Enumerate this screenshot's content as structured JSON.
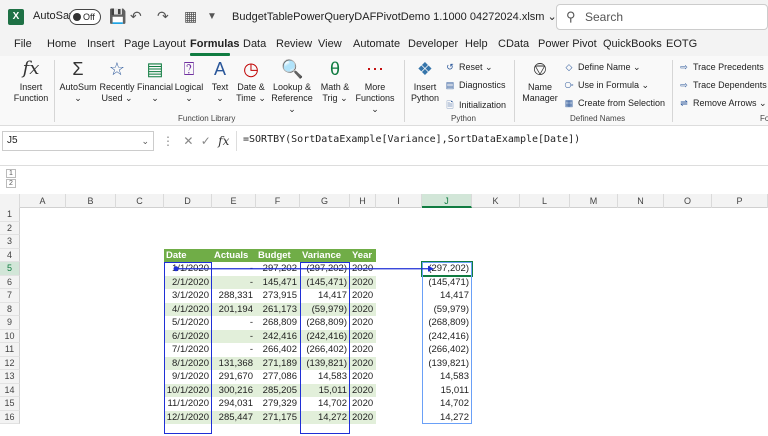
{
  "titlebar": {
    "app_badge": "X",
    "autosave_label": "AutoSave",
    "autosave_state": "Off",
    "document_title": "BudgetTablePowerQueryDAFPivotDemo 1.1000  04272024.xlsm",
    "search_placeholder": "Search"
  },
  "tabs": [
    "File",
    "Home",
    "Insert",
    "Page Layout",
    "Formulas",
    "Data",
    "Review",
    "View",
    "Automate",
    "Developer",
    "Help",
    "CData",
    "Power Pivot",
    "QuickBooks",
    "EOTG"
  ],
  "active_tab": "Formulas",
  "ribbon": {
    "insert_function": [
      "Insert",
      "Function"
    ],
    "autosum": "AutoSum",
    "recently_used": [
      "Recently",
      "Used"
    ],
    "financial": "Financial",
    "logical": "Logical",
    "text": "Text",
    "date_time": [
      "Date &",
      "Time"
    ],
    "lookup_reference": [
      "Lookup &",
      "Reference"
    ],
    "math_trig": [
      "Math &",
      "Trig"
    ],
    "more_functions": [
      "More",
      "Functions"
    ],
    "group_function_library": "Function Library",
    "insert_python": [
      "Insert",
      "Python"
    ],
    "reset": "Reset",
    "diagnostics": "Diagnostics",
    "initialization": "Initialization",
    "group_python": "Python",
    "name_manager": [
      "Name",
      "Manager"
    ],
    "define_name": "Define Name",
    "use_in_formula": "Use in Formula",
    "create_from_selection": "Create from Selection",
    "group_defined_names": "Defined Names",
    "trace_precedents": "Trace Precedents",
    "trace_dependents": "Trace Dependents",
    "remove_arrows": "Remove Arrows",
    "group_formula_auditing_partial": "Fo"
  },
  "formula_bar": {
    "name_box": "J5",
    "fx": "fx",
    "formula": "=SORTBY(SortDataExample[Variance],SortDataExample[Date])"
  },
  "outline_levels": [
    "1",
    "2"
  ],
  "columns": [
    "A",
    "B",
    "C",
    "D",
    "E",
    "F",
    "G",
    "H",
    "I",
    "J",
    "K",
    "L",
    "M",
    "N",
    "O",
    "P"
  ],
  "selected_column": "J",
  "rows": [
    "1",
    "2",
    "3",
    "4",
    "5",
    "6",
    "7",
    "8",
    "9",
    "10",
    "11",
    "12",
    "13",
    "14",
    "15",
    "16"
  ],
  "selected_row": "5",
  "table": {
    "headers": [
      "Date",
      "Actuals",
      "Budget",
      "Variance",
      "Year"
    ],
    "rows": [
      [
        "1/1/2020",
        "-",
        "297,202",
        "(297,202)",
        "2020"
      ],
      [
        "2/1/2020",
        "-",
        "145,471",
        "(145,471)",
        "2020"
      ],
      [
        "3/1/2020",
        "288,331",
        "273,915",
        "14,417",
        "2020"
      ],
      [
        "4/1/2020",
        "201,194",
        "261,173",
        "(59,979)",
        "2020"
      ],
      [
        "5/1/2020",
        "-",
        "268,809",
        "(268,809)",
        "2020"
      ],
      [
        "6/1/2020",
        "-",
        "242,416",
        "(242,416)",
        "2020"
      ],
      [
        "7/1/2020",
        "-",
        "266,402",
        "(266,402)",
        "2020"
      ],
      [
        "8/1/2020",
        "131,368",
        "271,189",
        "(139,821)",
        "2020"
      ],
      [
        "9/1/2020",
        "291,670",
        "277,086",
        "14,583",
        "2020"
      ],
      [
        "10/1/2020",
        "300,216",
        "285,205",
        "15,011",
        "2020"
      ],
      [
        "11/1/2020",
        "294,031",
        "279,329",
        "14,702",
        "2020"
      ],
      [
        "12/1/2020",
        "285,447",
        "271,175",
        "14,272",
        "2020"
      ]
    ]
  },
  "spill_values": [
    "(297,202)",
    "(145,471)",
    "14,417",
    "(59,979)",
    "(268,809)",
    "(242,416)",
    "(266,402)",
    "(139,821)",
    "14,583",
    "15,011",
    "14,702",
    "14,272"
  ],
  "colors": {
    "accent": "#107c41",
    "table_header": "#70ad47",
    "band": "#e2efda",
    "trace_blue": "#1f2fd6"
  }
}
